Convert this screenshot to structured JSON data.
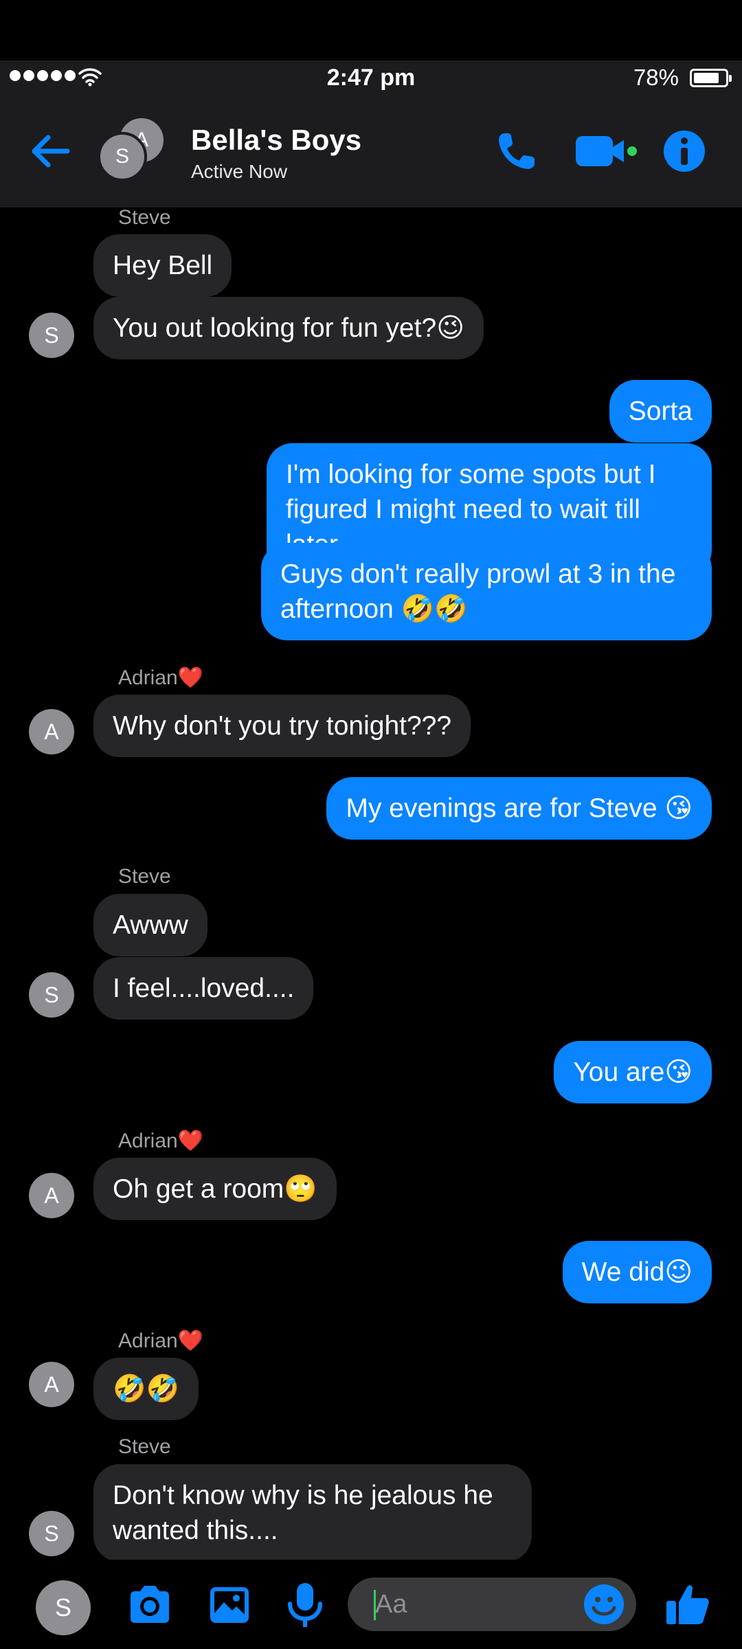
{
  "status_bar": {
    "time": "2:47 pm",
    "battery": "78%"
  },
  "header": {
    "title": "Bella's Boys",
    "subtitle": "Active Now",
    "avatar_back": "A",
    "avatar_front": "S"
  },
  "messages": [
    {
      "sender": "Steve"
    },
    {
      "text": "Hey Bell"
    },
    {
      "text": "You out looking for fun yet?😉",
      "avatar": "S"
    },
    {
      "text": "Sorta"
    },
    {
      "text": "I'm looking for some spots but I figured I might need to wait till later...."
    },
    {
      "text": "Guys don't really prowl at 3 in the afternoon 🤣🤣"
    },
    {
      "sender": "Adrian❤️"
    },
    {
      "text": "Why don't you try tonight???",
      "avatar": "A"
    },
    {
      "text": "My evenings are for Steve 😘"
    },
    {
      "sender": "Steve"
    },
    {
      "text": "Awww"
    },
    {
      "text": "I feel....loved....",
      "avatar": "S"
    },
    {
      "text": "You are😘"
    },
    {
      "sender": "Adrian❤️"
    },
    {
      "text": "Oh get a room🙄",
      "avatar": "A"
    },
    {
      "text": "We did😉"
    },
    {
      "sender": "Adrian❤️"
    },
    {
      "text": "🤣🤣",
      "avatar": "A"
    },
    {
      "sender": "Steve"
    },
    {
      "text": "Don't know why is he jealous he wanted this....",
      "avatar": "S"
    }
  ],
  "composer": {
    "placeholder": "Aa",
    "me_avatar": "S"
  },
  "colors": {
    "accent": "#0a84ff",
    "incoming_bubble": "#262629",
    "header_bg": "#1c1c1e",
    "active_dot": "#30d158"
  },
  "icons": [
    "back-arrow-icon",
    "phone-icon",
    "video-camera-icon",
    "info-icon",
    "camera-icon",
    "photo-icon",
    "microphone-icon",
    "emoji-icon",
    "thumbs-up-icon",
    "wifi-icon",
    "battery-icon"
  ]
}
